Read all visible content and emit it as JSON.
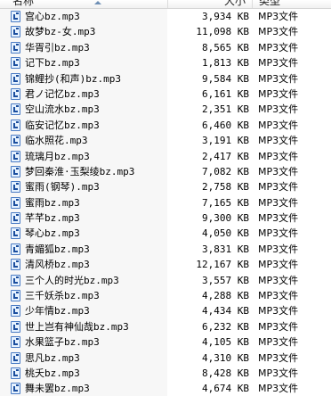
{
  "header": {
    "name": "名称",
    "size": "大小",
    "type": "类型"
  },
  "files": [
    {
      "name": "宫心bz.mp3",
      "size": "3,934 KB",
      "type": "MP3文件"
    },
    {
      "name": "故梦bz-女.mp3",
      "size": "11,098 KB",
      "type": "MP3文件"
    },
    {
      "name": "华胥引bz.mp3",
      "size": "8,565 KB",
      "type": "MP3文件"
    },
    {
      "name": "记下bz.mp3",
      "size": "1,813 KB",
      "type": "MP3文件"
    },
    {
      "name": "锦鲤抄(和声)bz.mp3",
      "size": "9,584 KB",
      "type": "MP3文件"
    },
    {
      "name": "君ノ记忆bz.mp3",
      "size": "6,161 KB",
      "type": "MP3文件"
    },
    {
      "name": "空山流水bz.mp3",
      "size": "2,351 KB",
      "type": "MP3文件"
    },
    {
      "name": "临安记忆bz.mp3",
      "size": "6,460 KB",
      "type": "MP3文件"
    },
    {
      "name": "临水照花.mp3",
      "size": "3,191 KB",
      "type": "MP3文件"
    },
    {
      "name": "琉璃月bz.mp3",
      "size": "2,417 KB",
      "type": "MP3文件"
    },
    {
      "name": "梦回秦淮·玉梨绫bz.mp3",
      "size": "7,082 KB",
      "type": "MP3文件"
    },
    {
      "name": "蜜雨(钢琴).mp3",
      "size": "2,758 KB",
      "type": "MP3文件"
    },
    {
      "name": "蜜雨bz.mp3",
      "size": "7,165 KB",
      "type": "MP3文件"
    },
    {
      "name": "芊芊bz.mp3",
      "size": "9,300 KB",
      "type": "MP3文件"
    },
    {
      "name": "琴心bz.mp3",
      "size": "4,050 KB",
      "type": "MP3文件"
    },
    {
      "name": "青媚狐bz.mp3",
      "size": "3,831 KB",
      "type": "MP3文件"
    },
    {
      "name": "清风桥bz.mp3",
      "size": "12,167 KB",
      "type": "MP3文件"
    },
    {
      "name": "三个人的时光bz.mp3",
      "size": "3,557 KB",
      "type": "MP3文件"
    },
    {
      "name": "三千妖杀bz.mp3",
      "size": "4,288 KB",
      "type": "MP3文件"
    },
    {
      "name": "少年情bz.mp3",
      "size": "4,434 KB",
      "type": "MP3文件"
    },
    {
      "name": "世上岂有神仙哉bz.mp3",
      "size": "6,232 KB",
      "type": "MP3文件"
    },
    {
      "name": "水果篮子bz.mp3",
      "size": "4,105 KB",
      "type": "MP3文件"
    },
    {
      "name": "思凡bz.mp3",
      "size": "4,310 KB",
      "type": "MP3文件"
    },
    {
      "name": "桃夭bz.mp3",
      "size": "8,428 KB",
      "type": "MP3文件"
    },
    {
      "name": "舞未罢bz.mp3",
      "size": "4,674 KB",
      "type": "MP3文件"
    }
  ]
}
